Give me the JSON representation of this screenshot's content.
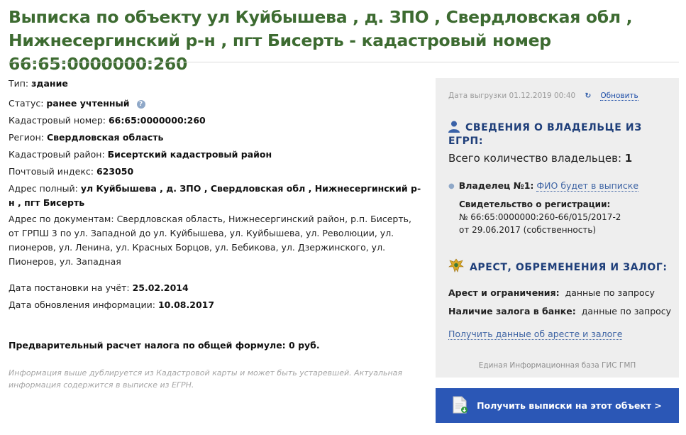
{
  "title": "Выписка по объекту ул Куйбышева , д. ЗПО , Свердловская обл , Нижнесергинский р-н , пгт Бисерть - кадастровый номер 66:65:0000000:260",
  "details": {
    "type_label": "Тип:",
    "type_value": "здание",
    "status_label": "Статус:",
    "status_value": "ранее учтенный",
    "status_help": "?",
    "cadnum_label": "Кадастровый номер:",
    "cadnum_value": "66:65:0000000:260",
    "region_label": "Регион:",
    "region_value": "Свердловская область",
    "district_label": "Кадастровый район:",
    "district_value": "Бисертский кадастровый район",
    "postcode_label": "Почтовый индекс:",
    "postcode_value": "623050",
    "addr_full_label": "Адрес полный:",
    "addr_full_value": "ул Куйбышева , д. ЗПО , Свердловская обл , Нижнесергинский р-н , пгт Бисерть",
    "addr_docs_label": "Адрес по документам:",
    "addr_docs_value": "Свердловская область, Нижнесергинский район, р.п. Бисерть, от ГРПШ 3 по ул. Западной до ул. Куйбышева, ул. Куйбышева, ул. Революции, ул. пионеров, ул. Ленина, ул. Красных Борцов, ул. Бебикова, ул. Дзержинского, ул. Пионеров, ул. Западная",
    "registered_label": "Дата постановки на учёт:",
    "registered_value": "25.02.2014",
    "updated_label": "Дата обновления информации:",
    "updated_value": "10.08.2017",
    "tax_text": "Предварительный расчет налога по общей формуле: 0 руб.",
    "note": "Информация выше дублируется из Кадастровой карты и может быть устаревшей. Актуальная информация содержится в выписке из ЕГРН."
  },
  "panel": {
    "export_date": "Дата выгрузки 01.12.2019 00:40",
    "refresh_label": "Обновить",
    "owners_heading": "СВЕДЕНИЯ О ВЛАДЕЛЬЦЕ ИЗ ЕГРП:",
    "owners_total_label": "Всего количество владельцев:",
    "owners_total_value": "1",
    "owner1_label": "Владелец №1:",
    "owner1_link": "ФИО будет в выписке",
    "cert_label": "Свидетельство о регистрации:",
    "cert_line1": "№ 66:65:0000000:260-66/015/2017-2",
    "cert_line2": "от 29.06.2017 (собственность)",
    "arrest_heading": "АРЕСТ, ОБРЕМЕНЕНИЯ И ЗАЛОГ:",
    "arrest_label": "Арест и ограничения:",
    "arrest_value": "данные по запросу",
    "pledge_label": "Наличие залога в банке:",
    "pledge_value": "данные по запросу",
    "arrest_link": "Получить данные об аресте и залоге",
    "source": "Единая Информационная база ГИС ГМП"
  },
  "button": {
    "label": "Получить выписки на этот объект >"
  },
  "colors": {
    "title": "#3d6b31",
    "heading": "#1f3f7a",
    "link": "#3e64a4",
    "button": "#2b57b6",
    "panel_bg": "#eeeeee"
  },
  "icons": [
    "help-icon",
    "refresh-icon",
    "user-icon",
    "emblem-icon",
    "document-icon"
  ]
}
